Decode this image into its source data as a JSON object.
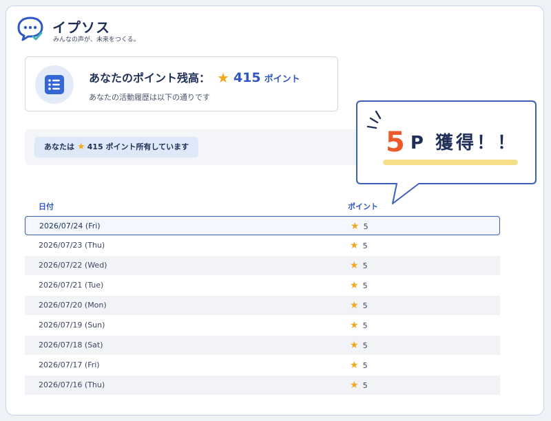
{
  "header": {
    "title": "イプソス",
    "tagline": "みんなの声が、未来をつくる。"
  },
  "balance": {
    "heading_prefix": "あなたのポイント残高：",
    "points": "415",
    "unit": "ポイント",
    "subtitle": "あなたの活動履歴は以下の通りです"
  },
  "summary": {
    "prefix": "あなたは",
    "points": "415",
    "suffix": "ポイント所有しています"
  },
  "callout": {
    "number": "5",
    "text": "P 獲得！！"
  },
  "table": {
    "columns": [
      "日付",
      "ポイント"
    ],
    "rows": [
      {
        "date": "2026/07/24 (Fri)",
        "points": "5"
      },
      {
        "date": "2026/07/23 (Thu)",
        "points": "5"
      },
      {
        "date": "2026/07/22 (Wed)",
        "points": "5"
      },
      {
        "date": "2026/07/21 (Tue)",
        "points": "5"
      },
      {
        "date": "2026/07/20 (Mon)",
        "points": "5"
      },
      {
        "date": "2026/07/19 (Sun)",
        "points": "5"
      },
      {
        "date": "2026/07/18 (Sat)",
        "points": "5"
      },
      {
        "date": "2026/07/17 (Fri)",
        "points": "5"
      },
      {
        "date": "2026/07/16 (Thu)",
        "points": "5"
      }
    ]
  },
  "icons": {
    "logo": "chat-bubble-check-icon",
    "balance": "list-icon",
    "star": "star-icon"
  },
  "colors": {
    "brand": "#1f2f57",
    "accent": "#2f56c4",
    "star": "#f1a81a",
    "highlight": "#ec5a2b"
  }
}
